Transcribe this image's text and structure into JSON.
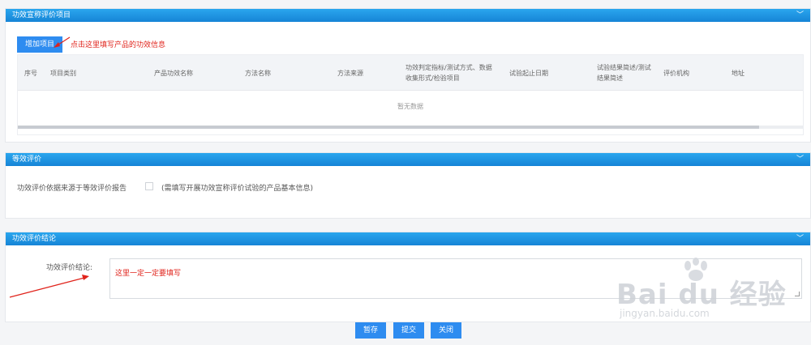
{
  "section1": {
    "title": "功效宣称评价项目",
    "add_button": "增加项目",
    "annotation": "点击这里填写产品的功效信息",
    "table": {
      "columns": [
        "序号",
        "项目类别",
        "产品功效名称",
        "方法名称",
        "方法来源",
        "功效判定指标/测试方式、数据收集形式/检验项目",
        "试验起止日期",
        "试验结果简述/测试结果简述",
        "评价机构",
        "地址"
      ],
      "empty_text": "暂无数据"
    }
  },
  "section2": {
    "title": "等效评价",
    "label": "功效评价依据来源于等效评价报告",
    "hint": "(需填写开展功效宣称评价试验的产品基本信息)"
  },
  "section3": {
    "title": "功效评价结论",
    "label": "功效评价结论:",
    "value": "这里一定一定要填写"
  },
  "footer": {
    "save": "暂存",
    "submit": "提交",
    "close": "关闭"
  },
  "icons": {
    "collapse": "chevron-down-icon",
    "arrow": "red-arrow-annotation"
  },
  "colors": {
    "header_blue": "#1a8ddf",
    "button_blue": "#2e8cf0",
    "annotation_red": "#e0231b"
  },
  "watermark": {
    "brand": "Bai du 经验",
    "sub": "jingyan.baidu.com"
  }
}
